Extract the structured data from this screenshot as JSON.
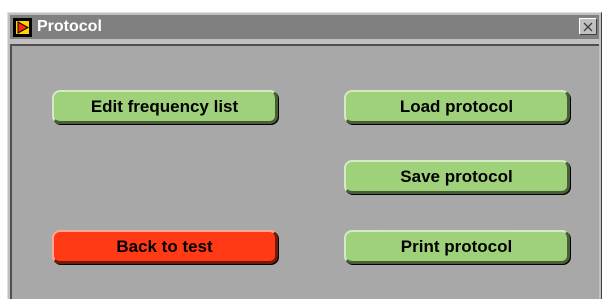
{
  "window": {
    "title": "Protocol",
    "close_symbol": "×"
  },
  "buttons": {
    "edit_frequency_list": "Edit frequency list",
    "load_protocol": "Load protocol",
    "save_protocol": "Save protocol",
    "back_to_test": "Back to test",
    "print_protocol": "Print protocol"
  },
  "colors": {
    "green_button": "#9fd07a",
    "red_button": "#ff3a14",
    "titlebar": "#808080",
    "panel": "#a8a8a8"
  },
  "icons": {
    "app": "labview-run-arrow-icon",
    "close": "close-icon"
  }
}
